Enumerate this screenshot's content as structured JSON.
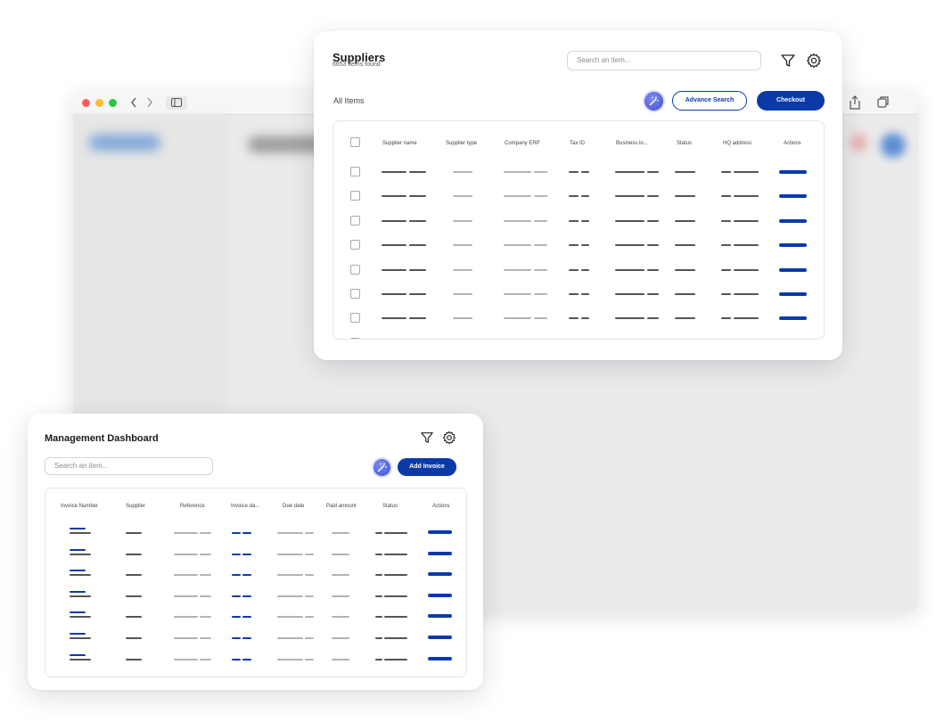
{
  "suppliers": {
    "title": "Suppliers",
    "count": "6653 items found",
    "search_placeholder": "Search an item...",
    "all_items_label": "All Items",
    "advance_search_label": "Advance Search",
    "checkout_label": "Checkout",
    "columns": [
      "Supplier name",
      "Supplier type",
      "Company ERP",
      "Tax ID",
      "Business lo...",
      "Status",
      "HQ address",
      "Actions"
    ]
  },
  "management": {
    "title": "Management Dashboard",
    "search_placeholder": "Search an item...",
    "add_invoice_label": "Add Invoice",
    "columns": [
      "Invoice Number",
      "Supplier",
      "Reference",
      "Invoice da...",
      "Due date",
      "Paid amount",
      "Status",
      "Actions"
    ]
  },
  "icons": {
    "filter": "filter-icon",
    "settings": "gear-icon",
    "ai": "magic-wand-icon",
    "share": "share-icon",
    "tabs": "tabs-icon",
    "sidebar": "sidebar-icon"
  },
  "colors": {
    "primary": "#0b3aa8",
    "ai_button": "#4a5ce0",
    "traffic_red": "#ff5f57",
    "traffic_yellow": "#febc2e",
    "traffic_green": "#28c840"
  }
}
